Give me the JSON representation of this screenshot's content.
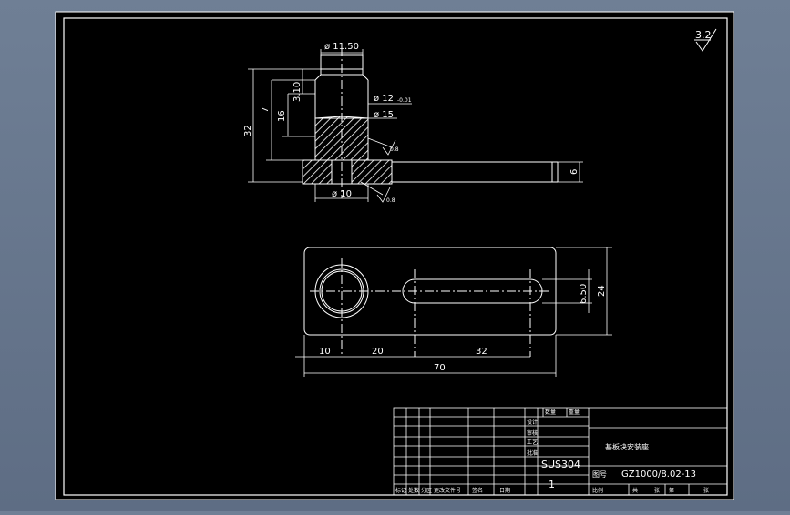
{
  "drawing": {
    "background_color": "#000000",
    "line_color": "#ffffff",
    "hatch_color": "#ffffff",
    "viewport_color": "#6b7b91"
  },
  "roughness": {
    "general": "3.2"
  },
  "front_view": {
    "dim_top_dia": "ø 11.50",
    "dim_head_height": "3.10",
    "dim_shaft_dia": "ø 12",
    "dim_shaft_tol": "-0.01",
    "dim_collar_dia": "ø 15",
    "dim_7": "7",
    "dim_16": "16",
    "dim_32": "32",
    "dim_6": "6",
    "dim_bottom_dia": "ø 10",
    "roughness_1": "0.8",
    "roughness_2": "0.8"
  },
  "top_view": {
    "dim_10": "10",
    "dim_20": "20",
    "dim_32": "32",
    "dim_70": "70",
    "dim_650": "6.50",
    "dim_24": "24"
  },
  "title_block": {
    "material": "SUS304",
    "quantity": "1",
    "part_name": "基板块安装座",
    "drawing_no_label": "图号",
    "drawing_no": "GZ1000/8.02-13",
    "qty_label": "数量",
    "weight_label": "重量",
    "scale_label": "比例",
    "row_labels": [
      "标记",
      "处数",
      "分区",
      "更改文件号",
      "签名",
      "日期"
    ],
    "side_labels": [
      "设计",
      "审核",
      "工艺",
      "批准"
    ],
    "bottom_labels": [
      "共",
      "张",
      "第",
      "张"
    ]
  }
}
